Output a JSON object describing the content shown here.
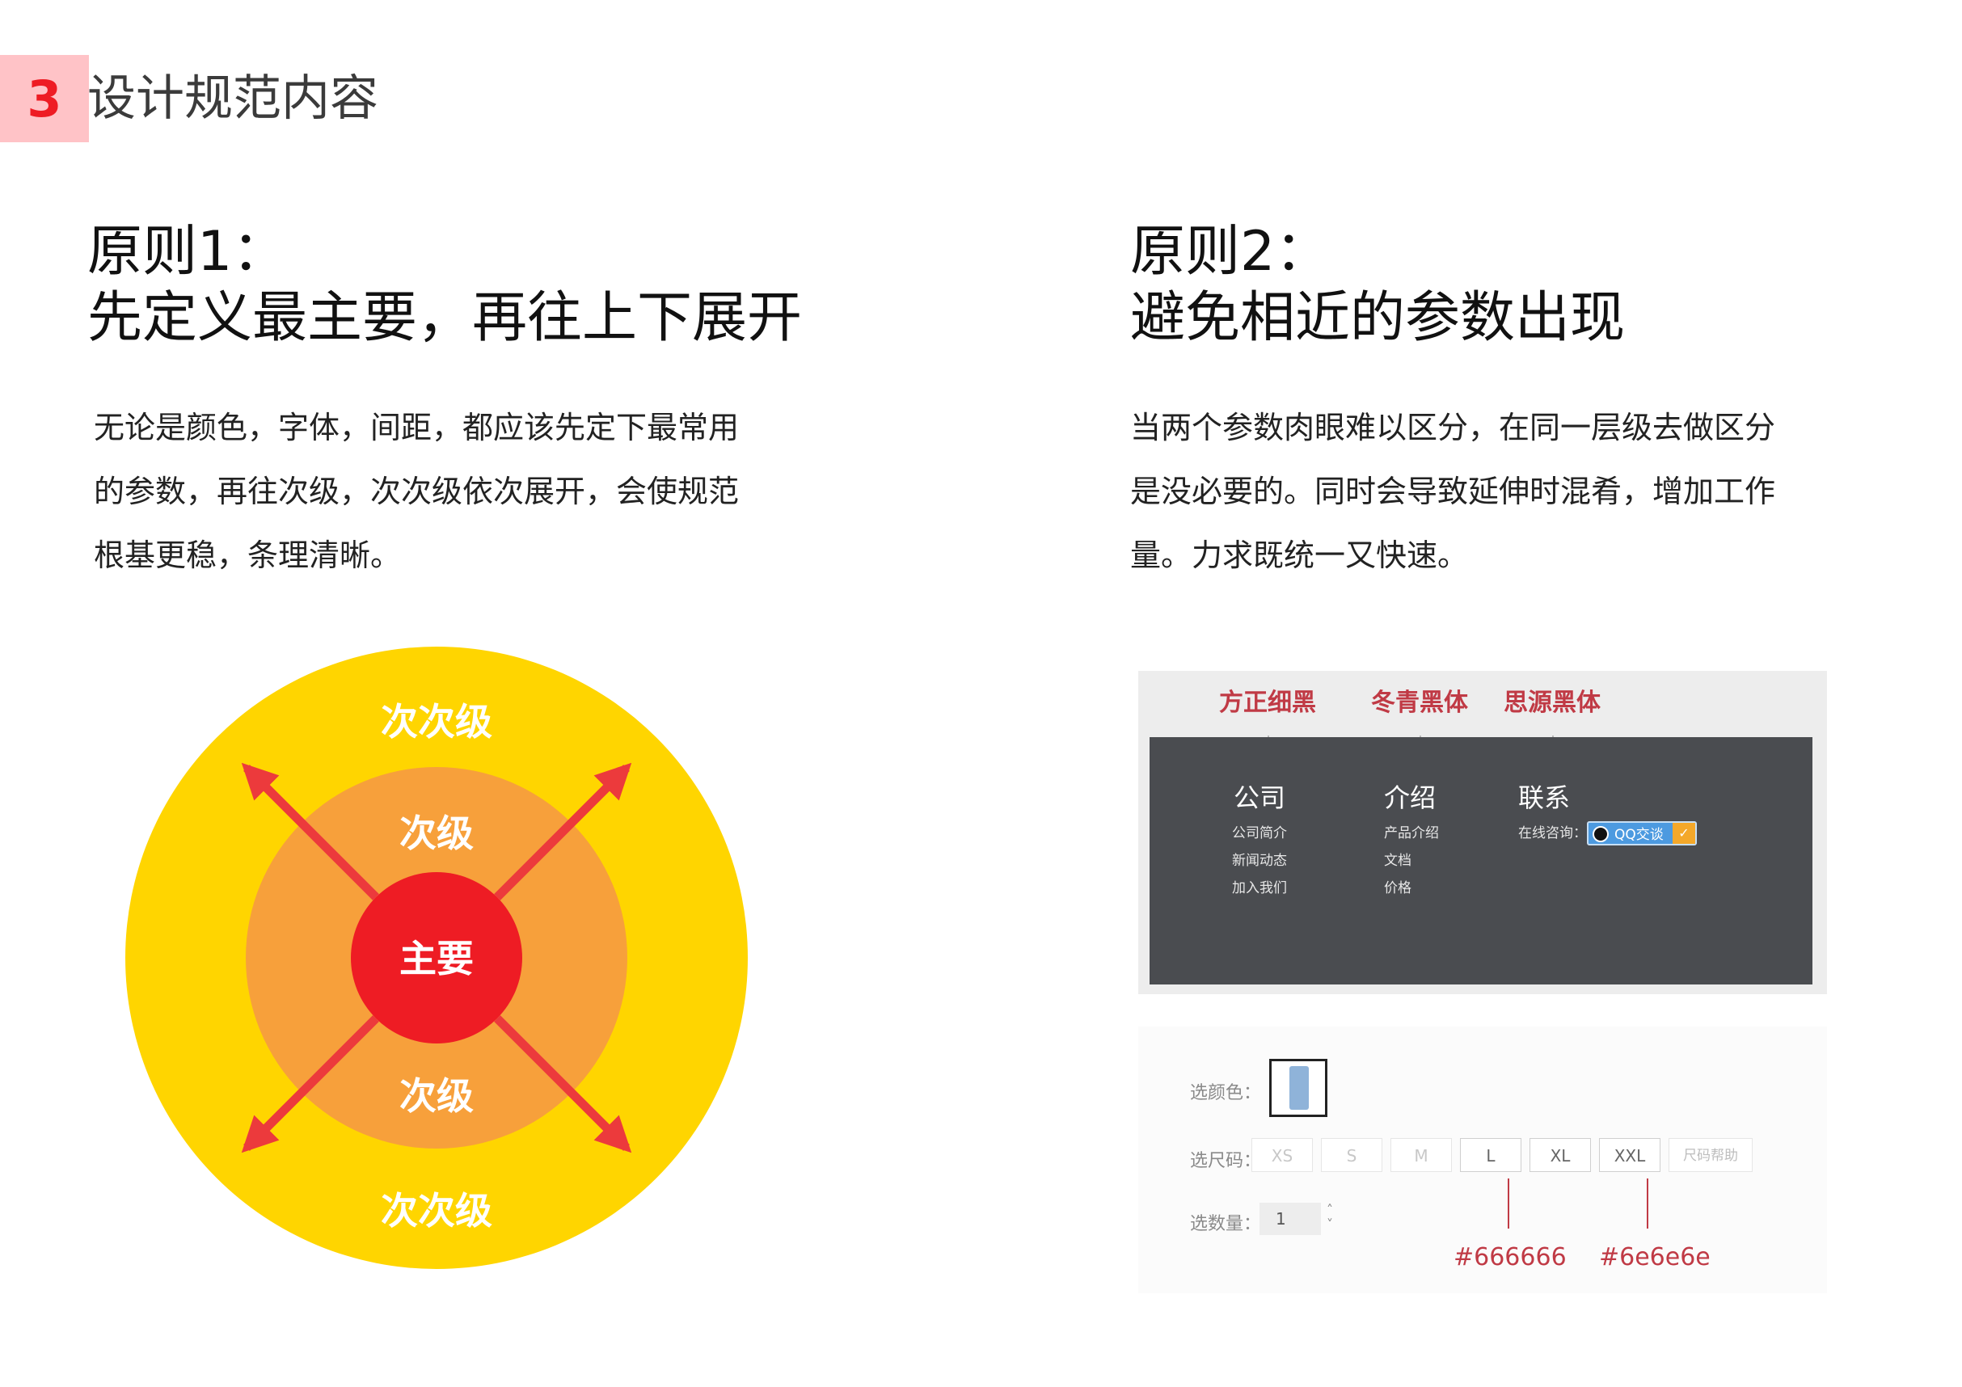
{
  "section": {
    "number": "3",
    "title": "设计规范内容"
  },
  "principle1": {
    "label": "原则1：",
    "title": "先定义最主要，再往上下展开",
    "lines": [
      "无论是颜色，字体，间距，都应该先定下最常用",
      "的参数，再往次级，次次级依次展开，会使规范",
      "根基更稳，条理清晰。"
    ],
    "diagram": {
      "outer_top": "次次级",
      "outer_bottom": "次次级",
      "middle_top": "次级",
      "middle_bottom": "次级",
      "center": "主要",
      "colors": {
        "outer": "#ffd500",
        "middle": "#f7a03b",
        "center": "#ee1c24",
        "arrow": "#ec3a3c"
      }
    }
  },
  "principle2": {
    "label": "原则2：",
    "title": "避免相近的参数出现",
    "lines": [
      "当两个参数肉眼难以区分，在同一层级去做区分",
      "是没必要的。同时会导致延伸时混肴，增加工作",
      "量。力求既统一又快速。"
    ],
    "mock_top": {
      "font_labels": [
        "方正细黑",
        "冬青黑体",
        "思源黑体"
      ],
      "columns": [
        {
          "title": "公司",
          "items": [
            "公司简介",
            "新闻动态",
            "加入我们"
          ]
        },
        {
          "title": "介绍",
          "items": [
            "产品介绍",
            "文档",
            "价格"
          ]
        },
        {
          "title": "联系",
          "items": [
            "在线咨询："
          ]
        }
      ],
      "qq_label": "QQ交谈"
    },
    "mock_bottom": {
      "color_label": "选颜色：",
      "size_label": "选尺码：",
      "sizes": [
        "XS",
        "S",
        "M",
        "L",
        "XL",
        "XXL"
      ],
      "size_help": "尺码帮助",
      "qty_label": "选数量：",
      "qty_value": "1",
      "hex_labels": [
        "#666666",
        "#6e6e6e"
      ]
    }
  }
}
